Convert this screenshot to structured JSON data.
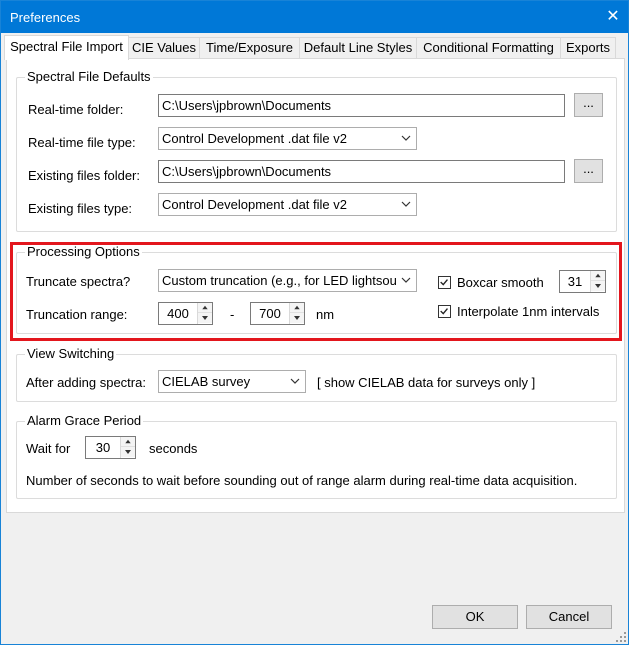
{
  "window": {
    "title": "Preferences"
  },
  "tabs": [
    {
      "label": "Spectral File Import"
    },
    {
      "label": "CIE Values"
    },
    {
      "label": "Time/Exposure"
    },
    {
      "label": "Default Line Styles"
    },
    {
      "label": "Conditional Formatting"
    },
    {
      "label": "Exports"
    }
  ],
  "spectral_file_defaults": {
    "title": "Spectral File Defaults",
    "realtime_folder_label": "Real-time folder:",
    "realtime_folder_value": "C:\\Users\\jpbrown\\Documents",
    "realtime_type_label": "Real-time file type:",
    "realtime_type_value": "Control Development .dat file v2",
    "existing_folder_label": "Existing files folder:",
    "existing_folder_value": "C:\\Users\\jpbrown\\Documents",
    "existing_type_label": "Existing files type:",
    "existing_type_value": "Control Development .dat file v2",
    "browse_label": "..."
  },
  "processing_options": {
    "title": "Processing Options",
    "truncate_label": "Truncate spectra?",
    "truncate_value": "Custom truncation (e.g., for LED lightsou",
    "range_label": "Truncation range:",
    "range_min": "400",
    "range_sep": "-",
    "range_max": "700",
    "range_unit": "nm",
    "boxcar_label": "Boxcar smooth",
    "boxcar_checked": true,
    "boxcar_value": "31",
    "interpolate_label": "Interpolate 1nm intervals",
    "interpolate_checked": true
  },
  "view_switching": {
    "title": "View Switching",
    "after_label": "After adding spectra:",
    "after_value": "CIELAB survey",
    "note": "[ show CIELAB data for surveys only ]"
  },
  "alarm": {
    "title": "Alarm Grace Period",
    "wait_label": "Wait for",
    "wait_value": "30",
    "seconds_label": "seconds",
    "description": "Number of seconds to wait before sounding out of range alarm during real-time data acquisition."
  },
  "footer": {
    "ok_label": "OK",
    "cancel_label": "Cancel"
  },
  "colors": {
    "titlebar": "#0078d7",
    "highlight": "#e3161d"
  }
}
